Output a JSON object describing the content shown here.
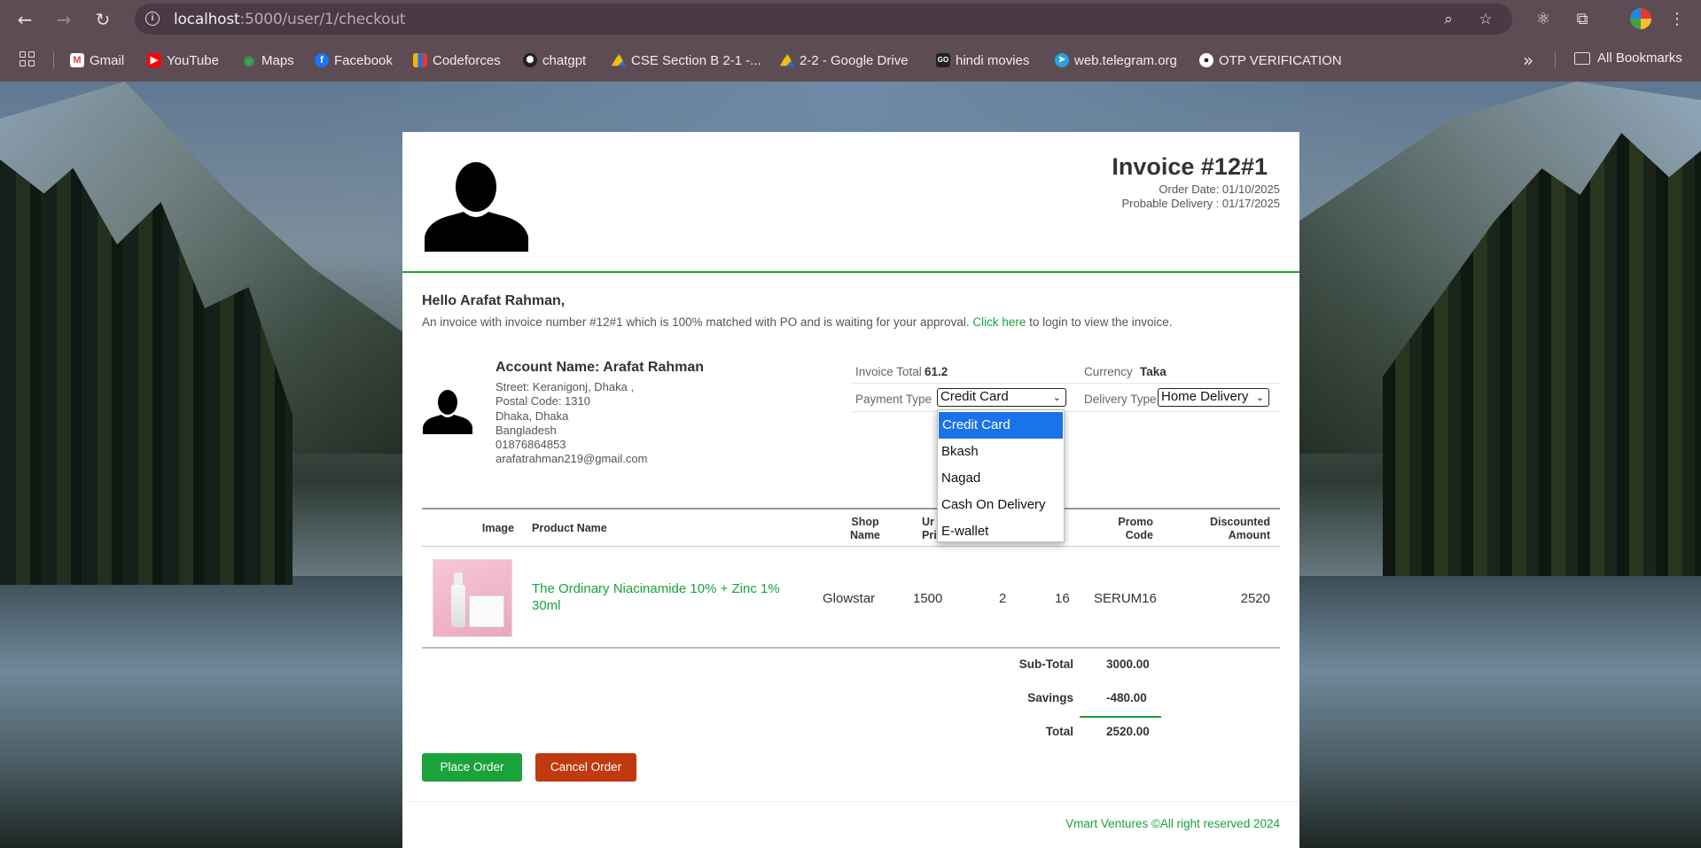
{
  "browser": {
    "url_host": "localhost",
    "url_path": ":5000/user/1/checkout",
    "bookmarks": [
      {
        "label": "Gmail",
        "icon": "gmail-icon",
        "color": "#ea4335"
      },
      {
        "label": "YouTube",
        "icon": "youtube-icon",
        "color": "#ff0000"
      },
      {
        "label": "Maps",
        "icon": "maps-icon",
        "color": "#34a853"
      },
      {
        "label": "Facebook",
        "icon": "facebook-icon",
        "color": "#1877f2"
      },
      {
        "label": "Codeforces",
        "icon": "codeforces-icon",
        "color": "#f5b400"
      },
      {
        "label": "chatgpt",
        "icon": "chatgpt-icon",
        "color": "#202020"
      },
      {
        "label": "CSE Section B 2-1 -...",
        "icon": "google-drive-icon",
        "color": "#1a73e8"
      },
      {
        "label": "2-2 - Google Drive",
        "icon": "google-drive-icon",
        "color": "#1a73e8"
      },
      {
        "label": "hindi movies",
        "icon": "movies-icon",
        "color": "#222222"
      },
      {
        "label": "web.telegram.org",
        "icon": "telegram-icon",
        "color": "#2aa1da"
      },
      {
        "label": "OTP VERIFICATION",
        "icon": "github-icon",
        "color": "#1b1f23"
      }
    ],
    "all_bookmarks": "All Bookmarks"
  },
  "invoice": {
    "title": "Invoice #12#1",
    "order_date": "Order Date: 01/10/2025",
    "probable_delivery": "Probable Delivery : 01/17/2025",
    "greeting": "Hello Arafat Rahman,",
    "intro_text": "An invoice with invoice number #12#1 which is 100% matched with PO and is waiting for your approval.",
    "intro_link": "Click here",
    "intro_tail": "to login to view the invoice."
  },
  "account": {
    "name": "Account Name: Arafat Rahman",
    "lines": [
      "Street: Keranigonj, Dhaka ,",
      "Postal Code: 1310",
      "Dhaka, Dhaka",
      "Bangladesh",
      "01876864853",
      "arafatrahman219@gmail.com"
    ]
  },
  "meta": {
    "invoice_total_label": "Invoice Total",
    "invoice_total_value": "61.2",
    "currency_label": "Currency",
    "currency_value": "Taka",
    "payment_type_label": "Payment Type",
    "payment_type_value": "Credit Card",
    "delivery_type_label": "Delivery Type",
    "delivery_type_value": "Home Delivery"
  },
  "payment_options": [
    "Credit Card",
    "Bkash",
    "Nagad",
    "Cash On Delivery",
    "E-wallet"
  ],
  "table": {
    "headers": {
      "image": "Image",
      "product_name": "Product Name",
      "shop_name_1": "Shop",
      "shop_name_2": "Name",
      "unit_price_1": "Ur",
      "unit_price_2": "Pric",
      "amount_tail": "nt",
      "promo_1": "Promo",
      "promo_2": "Code",
      "discounted_1": "Discounted",
      "discounted_2": "Amount"
    },
    "rows": [
      {
        "product": "The Ordinary Niacinamide 10% + Zinc 1% 30ml",
        "shop": "Glowstar",
        "unit_price": "1500",
        "quantity": "2",
        "discount": "16",
        "promo": "SERUM16",
        "discounted_amount": "2520"
      }
    ]
  },
  "totals": {
    "subtotal_label": "Sub-Total",
    "subtotal_value": "3000.00",
    "savings_label": "Savings",
    "savings_value": "-480.00",
    "total_label": "Total",
    "total_value": "2520.00"
  },
  "actions": {
    "place_order": "Place Order",
    "cancel_order": "Cancel Order"
  },
  "footer": "Vmart Ventures ©All right reserved 2024",
  "colors": {
    "accent_green": "#1aa23b",
    "cancel_red": "#c0390f",
    "dropdown_selected": "#1a73e8",
    "chrome_bg": "#5e4c55"
  }
}
